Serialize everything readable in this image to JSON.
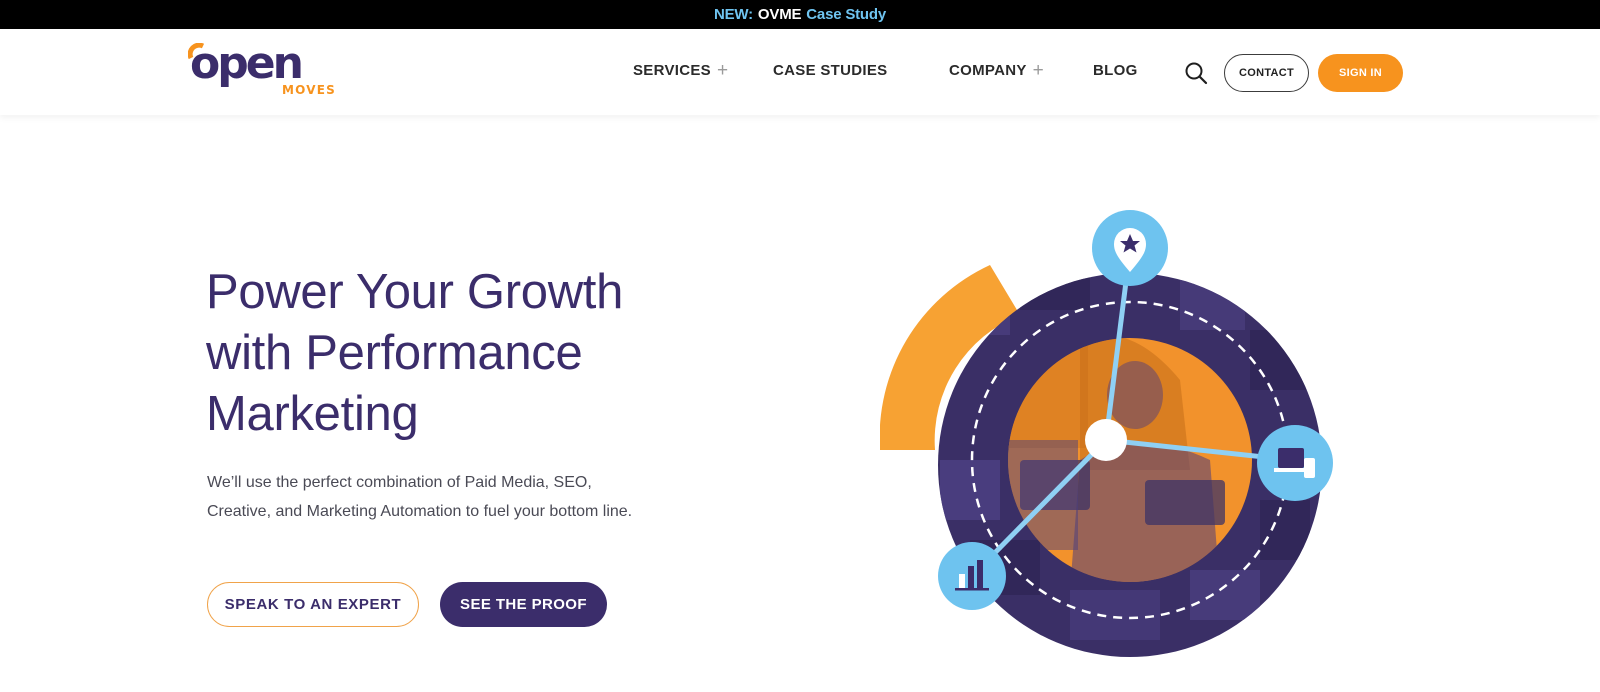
{
  "announcement": {
    "tag": "NEW:",
    "link_strong": "OVME",
    "link_rest": "Case Study"
  },
  "brand": {
    "logo_word": "open",
    "logo_sub": "MOVES",
    "accent_color": "#f7931e",
    "primary_color": "#3b2d6b",
    "light_blue": "#6fc4f0"
  },
  "nav": {
    "items": [
      {
        "label": "SERVICES",
        "has_submenu": true
      },
      {
        "label": "CASE STUDIES",
        "has_submenu": false
      },
      {
        "label": "COMPANY",
        "has_submenu": true
      },
      {
        "label": "BLOG",
        "has_submenu": false
      }
    ],
    "plus_symbol": "+",
    "search_icon": "search-icon",
    "contact_label": "CONTACT",
    "signin_label": "SIGN IN"
  },
  "hero": {
    "title_lines": [
      "Power Your Growth",
      "with Performance",
      "Marketing"
    ],
    "subtitle_lines": [
      "We’ll use the perfect combination of Paid Media, SEO,",
      "Creative, and Marketing Automation to fuel your bottom line."
    ],
    "cta_outline": "SPEAK TO AN EXPERT",
    "cta_solid": "SEE THE PROOF"
  },
  "illustration": {
    "icons": [
      "location-star-icon",
      "devices-icon",
      "bar-chart-icon"
    ]
  }
}
